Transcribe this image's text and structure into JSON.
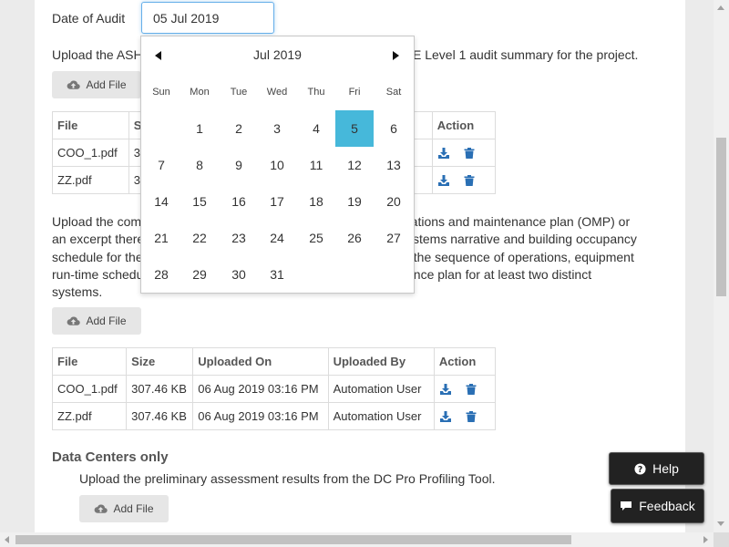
{
  "audit": {
    "date_label": "Date of Audit",
    "date_value": "05 Jul 2019"
  },
  "upload_1": {
    "text_visible_left": "Upload the ASH",
    "text_visible_right": "E Level 1 audit summary for the project.",
    "add_label": "Add File"
  },
  "table_1": {
    "headers": [
      "File",
      "Si",
      "Action"
    ],
    "rows": [
      {
        "file": "COO_1.pdf",
        "size": "30",
        "by": "er"
      },
      {
        "file": "ZZ.pdf",
        "size": "30",
        "by": "er"
      }
    ]
  },
  "upload_2": {
    "lines_left": [
      "Upload the com",
      "an excerpt there",
      "schedule for the",
      "run-time schedu",
      "systems."
    ],
    "lines_right": [
      "rations and maintenance plan (OMP) or",
      "ystems narrative and building occupancy",
      "f the sequence of operations, equipment",
      "ance plan for at least two distinct"
    ],
    "add_label": "Add File"
  },
  "table_2": {
    "headers": [
      "File",
      "Size",
      "Uploaded On",
      "Uploaded By",
      "Action"
    ],
    "rows": [
      {
        "file": "COO_1.pdf",
        "size": "307.46 KB",
        "on": "06 Aug 2019 03:16 PM",
        "by": "Automation User"
      },
      {
        "file": "ZZ.pdf",
        "size": "307.46 KB",
        "on": "06 Aug 2019 03:16 PM",
        "by": "Automation User"
      }
    ]
  },
  "data_centers": {
    "title": "Data Centers only",
    "text": "Upload the preliminary assessment results from the DC Pro Profiling Tool.",
    "add_label": "Add File"
  },
  "datepicker": {
    "month_label": "Jul 2019",
    "weekdays": [
      "Sun",
      "Mon",
      "Tue",
      "Wed",
      "Thu",
      "Fri",
      "Sat"
    ],
    "days": [
      "1",
      "2",
      "3",
      "4",
      "5",
      "6",
      "7",
      "8",
      "9",
      "10",
      "11",
      "12",
      "13",
      "14",
      "15",
      "16",
      "17",
      "18",
      "19",
      "20",
      "21",
      "22",
      "23",
      "24",
      "25",
      "26",
      "27",
      "28",
      "29",
      "30",
      "31"
    ],
    "selected_day": "5",
    "first_weekday_index": 1
  },
  "floating": {
    "help_label": "Help",
    "feedback_label": "Feedback"
  },
  "icons": {
    "upload": "cloud-upload-icon",
    "download": "download-icon",
    "delete": "trash-icon",
    "help": "question-circle-icon",
    "feedback": "comment-icon"
  },
  "colors": {
    "selected_day": "#46b8da",
    "action_icon": "#2a6fb4",
    "floating_bg": "#222222"
  }
}
